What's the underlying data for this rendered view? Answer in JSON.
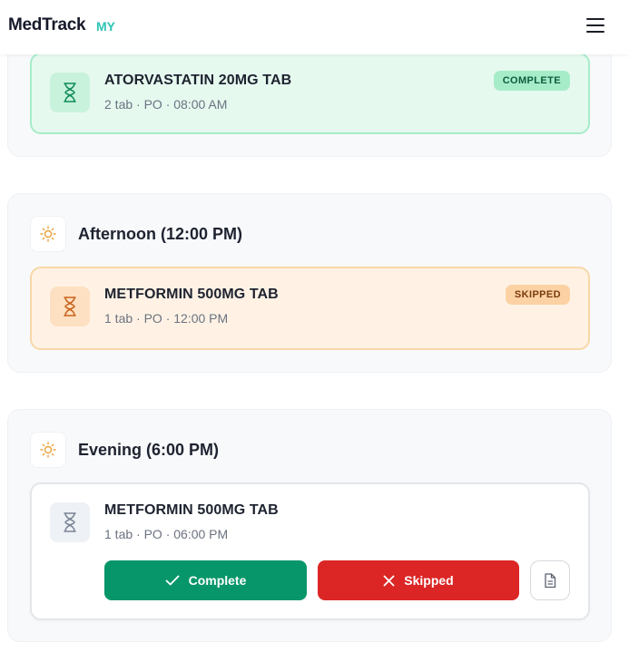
{
  "header": {
    "brand": "MedTrack",
    "brand_tag": "MY",
    "menu_icon": "hamburger-menu-icon"
  },
  "colors": {
    "complete": "#079669",
    "skipped": "#dc2626",
    "accent": "#2ec4b6"
  },
  "morning": {
    "card": {
      "name": "ATORVASTATIN 20MG TAB",
      "detail": "2 tab · PO · 08:00 AM",
      "status": "COMPLETE",
      "icon": "hourglass-icon"
    }
  },
  "afternoon": {
    "title": "Afternoon (12:00 PM)",
    "icon": "sun-icon",
    "card": {
      "name": "METFORMIN 500MG TAB",
      "detail": "1 tab · PO · 12:00 PM",
      "status": "SKIPPED",
      "icon": "hourglass-icon"
    }
  },
  "evening": {
    "title": "Evening (6:00 PM)",
    "icon": "sun-icon",
    "card": {
      "name": "METFORMIN 500MG TAB",
      "detail": "1 tab · PO · 06:00 PM",
      "icon": "hourglass-icon"
    },
    "actions": {
      "complete_label": "Complete",
      "skip_label": "Skipped",
      "note_icon": "document-icon"
    }
  }
}
